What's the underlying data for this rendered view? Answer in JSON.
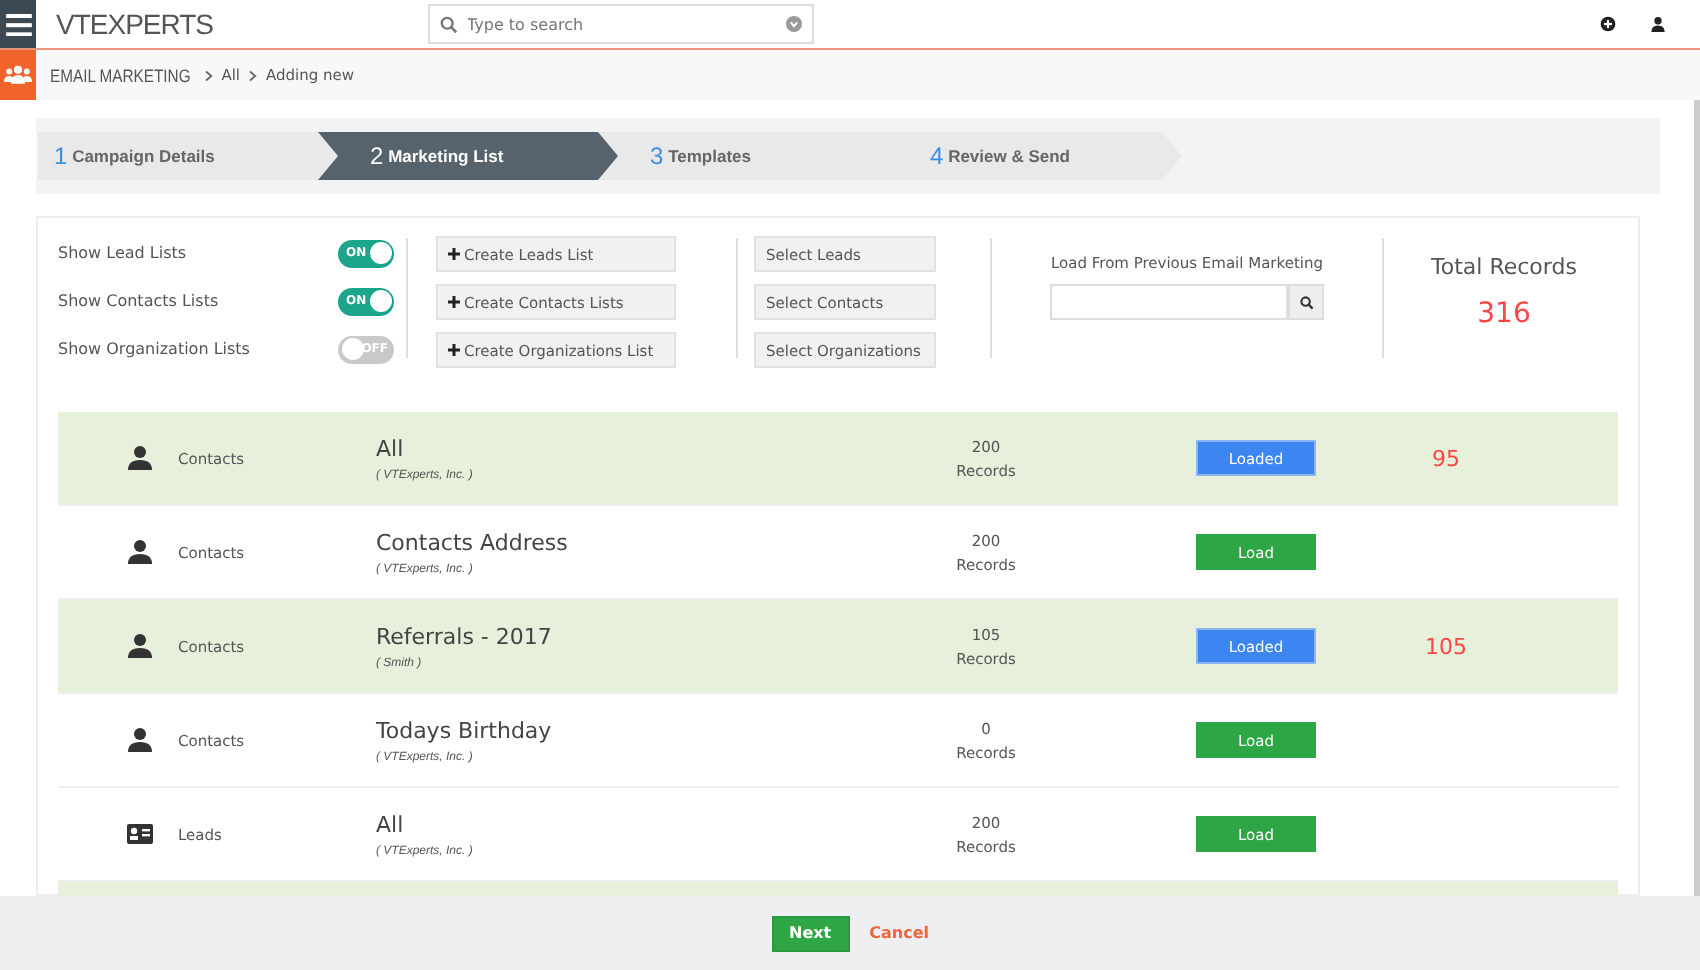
{
  "header": {
    "logo": "VTEXPERTS",
    "search": {
      "placeholder": "Type to search"
    }
  },
  "breadcrumb": {
    "module": "EMAIL MARKETING",
    "items": [
      "All",
      "Adding new"
    ]
  },
  "steps": [
    {
      "number": "1",
      "label": "Campaign Details",
      "selected": false
    },
    {
      "number": "2",
      "label": "Marketing List",
      "selected": true
    },
    {
      "number": "3",
      "label": "Templates",
      "selected": false
    },
    {
      "number": "4",
      "label": "Review & Send",
      "selected": false
    }
  ],
  "toggles": [
    {
      "label": "Show Lead Lists",
      "on": true,
      "text": "ON"
    },
    {
      "label": "Show Contacts Lists",
      "on": true,
      "text": "ON"
    },
    {
      "label": "Show Organization Lists",
      "on": false,
      "text": "OFF"
    }
  ],
  "create_buttons": [
    "Create Leads List",
    "Create Contacts Lists",
    "Create Organizations List"
  ],
  "select_buttons": [
    "Select Leads",
    "Select Contacts",
    "Select Organizations"
  ],
  "previous": {
    "label": "Load From Previous Email Marketing"
  },
  "total": {
    "label": "Total Records",
    "value": "316"
  },
  "rows": [
    {
      "kind": "contact",
      "type": "Contacts",
      "name": "All",
      "owner": "( VTExperts, Inc. )",
      "count": "200",
      "unit": "Records",
      "loaded": true,
      "button": "Loaded",
      "loaded_count": "95"
    },
    {
      "kind": "contact",
      "type": "Contacts",
      "name": "Contacts Address",
      "owner": "( VTExperts, Inc. )",
      "count": "200",
      "unit": "Records",
      "loaded": false,
      "button": "Load"
    },
    {
      "kind": "contact",
      "type": "Contacts",
      "name": "Referrals - 2017",
      "owner": "( Smith )",
      "count": "105",
      "unit": "Records",
      "loaded": true,
      "button": "Loaded",
      "loaded_count": "105"
    },
    {
      "kind": "contact",
      "type": "Contacts",
      "name": "Todays Birthday",
      "owner": "( VTExperts, Inc. )",
      "count": "0",
      "unit": "Records",
      "loaded": false,
      "button": "Load"
    },
    {
      "kind": "lead",
      "type": "Leads",
      "name": "All",
      "owner": "( VTExperts, Inc. )",
      "count": "200",
      "unit": "Records",
      "loaded": false,
      "button": "Load"
    }
  ],
  "partial_row": {
    "loaded": true
  },
  "footer": {
    "next": "Next",
    "cancel": "Cancel"
  }
}
